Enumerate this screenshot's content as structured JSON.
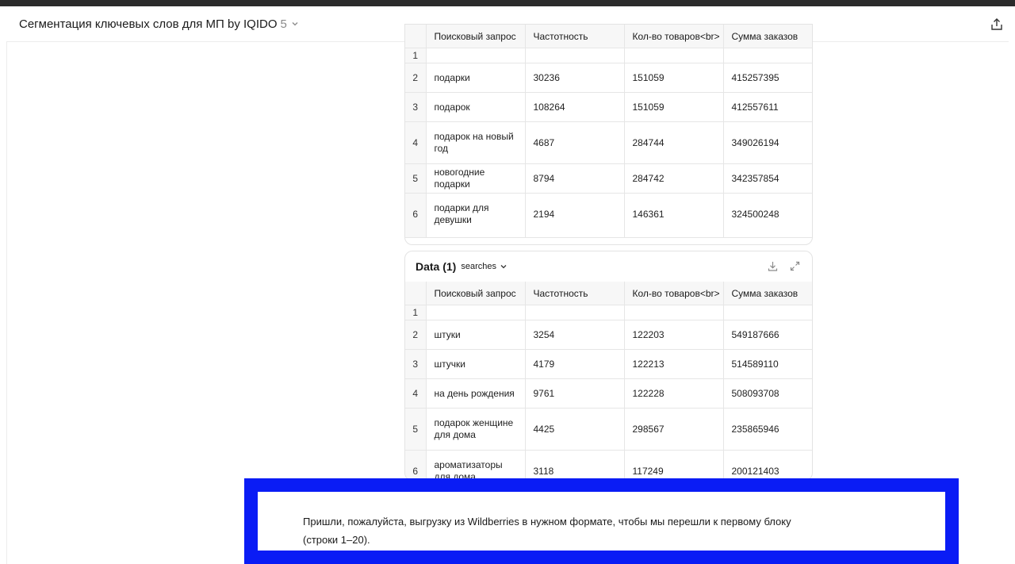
{
  "header": {
    "title": "Сегментация ключевых слов для МП by IQIDO",
    "version": "5"
  },
  "columns": [
    "Поисковый запрос",
    "Частотность",
    "Кол-во товаров<br>",
    "Сумма заказов"
  ],
  "table1": {
    "rows": [
      {
        "idx": "1",
        "query": "",
        "freq": "",
        "count": "",
        "sum": ""
      },
      {
        "idx": "2",
        "query": "подарки",
        "freq": "30236",
        "count": "151059",
        "sum": "415257395"
      },
      {
        "idx": "3",
        "query": "подарок",
        "freq": "108264",
        "count": "151059",
        "sum": "412557611"
      },
      {
        "idx": "4",
        "query": "подарок на новый год",
        "freq": "4687",
        "count": "284744",
        "sum": "349026194"
      },
      {
        "idx": "5",
        "query": "новогодние подарки",
        "freq": "8794",
        "count": "284742",
        "sum": "342357854"
      },
      {
        "idx": "6",
        "query": "подарки для девушки",
        "freq": "2194",
        "count": "146361",
        "sum": "324500248"
      }
    ]
  },
  "card2": {
    "name": "Data (1)",
    "sheet": "searches",
    "rows": [
      {
        "idx": "1",
        "query": "",
        "freq": "",
        "count": "",
        "sum": ""
      },
      {
        "idx": "2",
        "query": "штуки",
        "freq": "3254",
        "count": "122203",
        "sum": "549187666"
      },
      {
        "idx": "3",
        "query": "штучки",
        "freq": "4179",
        "count": "122213",
        "sum": "514589110"
      },
      {
        "idx": "4",
        "query": "на день рождения",
        "freq": "9761",
        "count": "122228",
        "sum": "508093708"
      },
      {
        "idx": "5",
        "query": "подарок женщине для дома",
        "freq": "4425",
        "count": "298567",
        "sum": "235865946"
      },
      {
        "idx": "6",
        "query": "ароматизаторы для дома",
        "freq": "3118",
        "count": "117249",
        "sum": "200121403"
      }
    ]
  },
  "message": {
    "text": "Пришли, пожалуйста, выгрузку из Wildberries в нужном формате, чтобы мы перешли к первому блоку (строки 1–20)."
  },
  "colors": {
    "overlay_border": "#0a1cf5",
    "header_bg": "#f7f7f7",
    "grid": "#e6e6e6"
  },
  "icons": {
    "share": "share-icon",
    "dropdown": "chevron-down-icon",
    "download": "download-icon",
    "expand": "expand-icon"
  }
}
